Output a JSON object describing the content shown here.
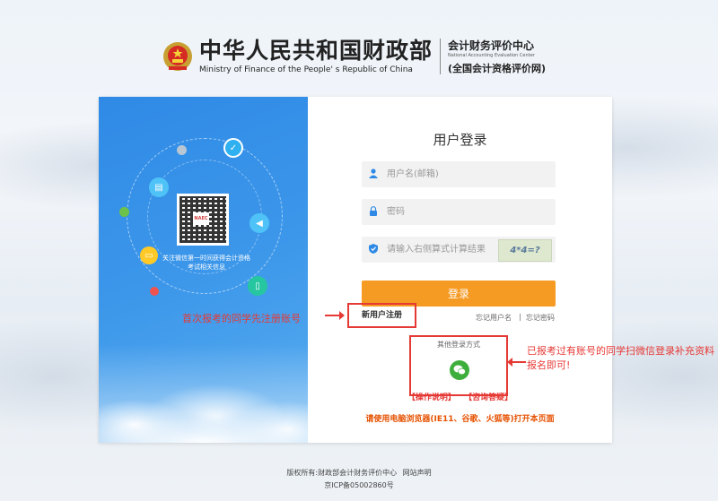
{
  "header": {
    "ministry_cn": "中华人民共和国财政部",
    "ministry_en": "Ministry of Finance of the People' s Republic of China",
    "center_cn": "会计财务评价中心",
    "center_en": "National Accounting Evaluation Center",
    "center_sub": "(全国会计资格评价网)"
  },
  "left_panel": {
    "qr_logo": "NAEC",
    "follow_text": "关注微信第一时间获得会计资格考试相关信息"
  },
  "form": {
    "title": "用户登录",
    "username_placeholder": "用户名(邮箱)",
    "password_placeholder": "密码",
    "captcha_placeholder": "请输入右侧算式计算结果",
    "captcha_text": "4*4=?",
    "login_label": "登录",
    "register_label": "新用户注册",
    "forgot_username": "忘记用户名",
    "forgot_password": "忘记密码",
    "separator": "|",
    "other_login": "其他登录方式",
    "help_link": "【操作说明】",
    "consult_link": "【咨询答疑】",
    "browser_tip": "请使用电脑浏览器(IE11、谷歌、火狐等)打开本页面"
  },
  "annotations": {
    "left": "首次报考的同学先注册账号",
    "right": "已报考过有账号的同学扫微信登录补充资料报名即可!"
  },
  "footer": {
    "copyright": "版权所有:财政部会计财务评价中心",
    "statement": "网站声明",
    "icp": "京ICP备05002860号"
  },
  "colors": {
    "accent_blue": "#2f8ae6",
    "login_orange": "#f59a23",
    "annotation_red": "#e53935",
    "wechat_green": "#3dae3b"
  }
}
